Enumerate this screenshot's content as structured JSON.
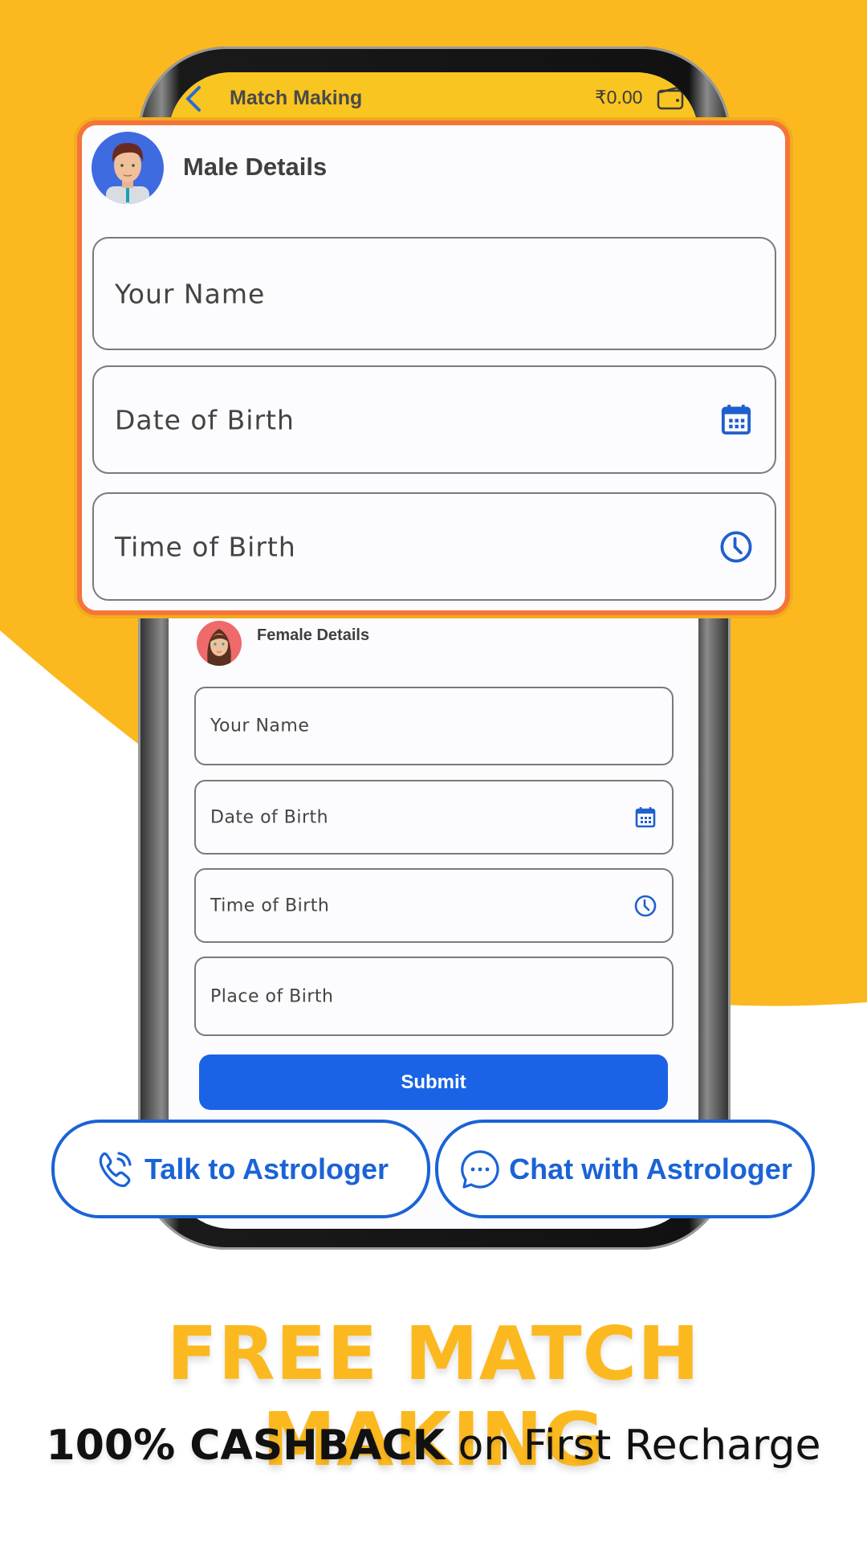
{
  "colors": {
    "background_yellow": "#fbb91f",
    "header_yellow": "#f9c520",
    "card_border": "#f5743a",
    "primary_blue": "#1a63e6",
    "action_blue": "#1a63d6"
  },
  "app_header": {
    "back_icon": "chevron-left-icon",
    "title": "Match Making",
    "balance": "₹0.00",
    "wallet_icon": "wallet-icon"
  },
  "male": {
    "title": "Male Details",
    "avatar": "male-avatar",
    "fields": [
      {
        "placeholder": "Your Name",
        "value": "",
        "icon": null
      },
      {
        "placeholder": "Date of Birth",
        "value": "",
        "icon": "calendar-icon"
      },
      {
        "placeholder": "Time of Birth",
        "value": "",
        "icon": "clock-icon"
      }
    ]
  },
  "female": {
    "title": "Female Details",
    "avatar": "female-avatar",
    "fields": [
      {
        "placeholder": "Your Name",
        "value": "",
        "icon": null
      },
      {
        "placeholder": "Date of Birth",
        "value": "",
        "icon": "calendar-icon"
      },
      {
        "placeholder": "Time of Birth",
        "value": "",
        "icon": "clock-icon"
      },
      {
        "placeholder": "Place of Birth",
        "value": "",
        "icon": null
      }
    ],
    "submit_label": "Submit"
  },
  "actions": {
    "talk": {
      "label": "Talk to Astrologer",
      "icon": "phone-call-icon"
    },
    "chat": {
      "label": "Chat with Astrologer",
      "icon": "chat-bubble-icon"
    }
  },
  "promo": {
    "headline": "FREE MATCH MAKING",
    "subline_bold": "100% CASHBACK",
    "subline_rest": " on First Recharge"
  }
}
